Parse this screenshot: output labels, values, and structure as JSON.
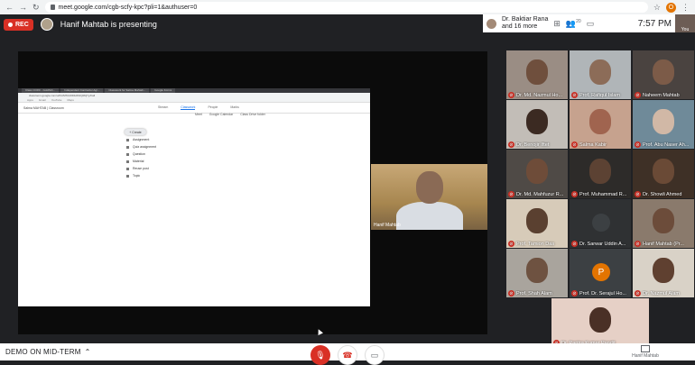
{
  "browser": {
    "url": "meet.google.com/cgb-scfy-kpc?pli=1&authuser=0",
    "profile_initial": "O"
  },
  "meet": {
    "rec_label": "REC",
    "presenter_text": "Hanif Mahtab is presenting",
    "participants_summary_line1": "Dr. Baktiar Rana",
    "participants_summary_line2": "and 16 more",
    "participant_count": "20",
    "time": "7:57 PM",
    "self_label": "You"
  },
  "shared_screen": {
    "tabs": [
      "Class CCRC - Goldfish...",
      "Independent Contractor Agr...",
      "Classwork for Salma Mahtab...",
      "Google Forms"
    ],
    "address": "classroom.google.com/u/0/c/MTA4ODk0NzQ0NjYy/t/all",
    "bookmarks": [
      "Apps",
      "Gmail",
      "YouTube",
      "Maps"
    ],
    "class_name": "Salma MAHTAB | Classroom",
    "nav": [
      "Stream",
      "Classwork",
      "People",
      "Marks"
    ],
    "tools": [
      "Meet",
      "Google Calendar",
      "Class Drive folder"
    ],
    "create_label": "+ Create",
    "menu": [
      "Assignment",
      "Quiz assignment",
      "Question",
      "Material",
      "Reuse post",
      "Topic"
    ]
  },
  "presenter_tile": {
    "name": "Hanif Mahtab"
  },
  "participants": [
    {
      "name": "Dr. Md. Nazmul Ho...",
      "bg": "#9a8d84",
      "head": "#6f4f3d"
    },
    {
      "name": "Prof. Rafiqul Islam",
      "bg": "#b0b5b8",
      "head": "#8c6c58"
    },
    {
      "name": "Naheem Mahtab",
      "bg": "#4a4340",
      "head": "#7c5b48"
    },
    {
      "name": "Dr. Benojir Iftet",
      "bg": "#c2bdb7",
      "head": "#3b2a22"
    },
    {
      "name": "Salma Kabir",
      "bg": "#c6a28e",
      "head": "#a0644f"
    },
    {
      "name": "Prof. Abu Naser Ah...",
      "bg": "#6f8a99",
      "head": "#d1b8a6"
    },
    {
      "name": "Dr. Md. Mahfuzur R...",
      "bg": "#4f4a46",
      "head": "#6e4c39"
    },
    {
      "name": "Prof. Muhammad R...",
      "bg": "#2d2b29",
      "head": "#5c4233"
    },
    {
      "name": "Dr. Showli Ahmed",
      "bg": "#3e3026",
      "head": "#6a4a36"
    },
    {
      "name": "Prof. Tamion Das",
      "bg": "#d7cbb9",
      "head": "#5a4030"
    },
    {
      "name": "Dr. Sarwar Uddin A...",
      "bg": "#2f3133",
      "head": "#4a3a30",
      "avatar": true,
      "avatar_color": "#3c4043"
    },
    {
      "name": "Hanif Mahtab (Pr...",
      "bg": "#8a7a6c",
      "head": "#6c4c3a"
    },
    {
      "name": "Prof. Shah Alam",
      "bg": "#a9a49d",
      "head": "#6e5241"
    },
    {
      "name": "Prof. Dr. Serajul Ho...",
      "bg": "#3c4043",
      "avatar": true,
      "avatar_letter": "P",
      "avatar_color": "#e37400"
    },
    {
      "name": "Dr. Nazmul Alam",
      "bg": "#d9d2c7",
      "head": "#5f4030"
    },
    {
      "name": "Dr. Paritra Kumar Pandit",
      "bg": "#e6d0c6",
      "head": "#4a3026"
    }
  ],
  "bottom": {
    "meeting_title": "DEMO ON MID-TERM",
    "present_label": "Hanif Mahtab"
  }
}
